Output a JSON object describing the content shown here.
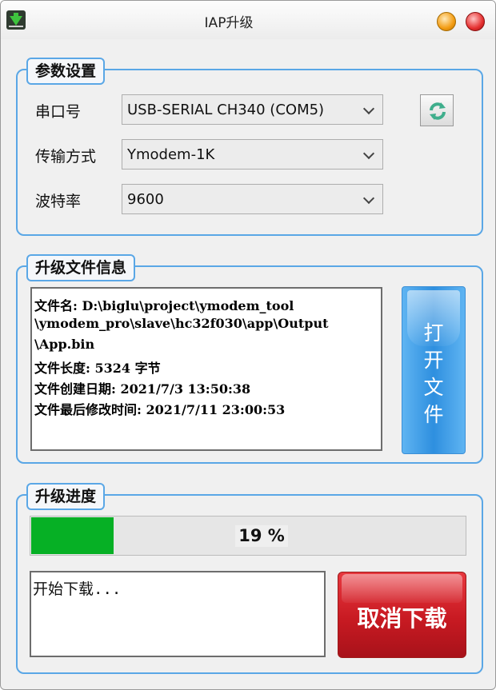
{
  "window": {
    "title": "IAP升级"
  },
  "params": {
    "legend": "参数设置",
    "port_label": "串口号",
    "port_value": "USB-SERIAL CH340 (COM5)",
    "protocol_label": "传输方式",
    "protocol_value": "Ymodem-1K",
    "baud_label": "波特率",
    "baud_value": "9600"
  },
  "file_info": {
    "legend": "升级文件信息",
    "lines": [
      "文件名: D:\\biglu\\project\\ymodem_tool",
      "\\ymodem_pro\\slave\\hc32f030\\app\\Output",
      "\\App.bin",
      "文件长度: 5324 字节",
      "文件创建日期: 2021/7/3 13:50:38",
      "文件最后修改时间: 2021/7/11 23:00:53"
    ],
    "open_button_chars": [
      "打",
      "开",
      "文",
      "件"
    ]
  },
  "progress": {
    "legend": "升级进度",
    "percent": 19,
    "percent_text": "19 %",
    "log_text": "开始下载...",
    "cancel_label": "取消下载"
  },
  "colors": {
    "accent_border": "#5aa7e6",
    "progress_fill": "#06b025",
    "cancel": "#c81a22",
    "open_btn": "#2e8fdf"
  },
  "icons": [
    "download-app-icon",
    "minimize-icon",
    "close-icon",
    "refresh-icon",
    "chevron-down-icon"
  ]
}
